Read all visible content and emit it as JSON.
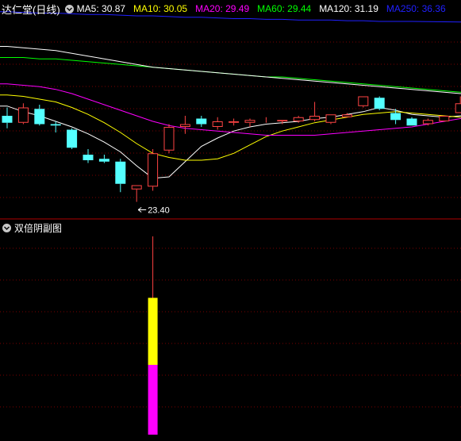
{
  "header": {
    "stock_title": "达仁堂(日线)",
    "ma_labels": [
      {
        "text": "MA5: 30.87",
        "color": "#ffffff"
      },
      {
        "text": "MA10: 30.05",
        "color": "#ffff00"
      },
      {
        "text": "MA20: 29.49",
        "color": "#ff00ff"
      },
      {
        "text": "MA60: 29.44",
        "color": "#00ff00"
      },
      {
        "text": "MA120: 31.19",
        "color": "#ffffff"
      },
      {
        "text": "MA250: 36.36",
        "color": "#2020ff"
      }
    ]
  },
  "sub_panel": {
    "title": "双倍阴副图"
  },
  "colors": {
    "up": "#ff4444",
    "down": "#54ffff",
    "grid": "#7a0000",
    "divider": "#b00000",
    "volume_top": "#ffff00",
    "volume_bottom": "#ff00ff",
    "volume_wick": "#ff4040"
  },
  "chart_data": {
    "type": "candlestick",
    "price_range": [
      22.4,
      36.8
    ],
    "low_annotation": "23.40",
    "candles": [
      {
        "o": 29.6,
        "h": 30.2,
        "l": 28.7,
        "c": 29.1
      },
      {
        "o": 29.1,
        "h": 30.5,
        "l": 29.0,
        "c": 30.2
      },
      {
        "o": 30.1,
        "h": 30.4,
        "l": 28.9,
        "c": 29.0
      },
      {
        "o": 29.0,
        "h": 29.2,
        "l": 28.4,
        "c": 28.9
      },
      {
        "o": 28.6,
        "h": 28.7,
        "l": 27.2,
        "c": 27.3
      },
      {
        "o": 26.8,
        "h": 27.2,
        "l": 26.2,
        "c": 26.4
      },
      {
        "o": 26.5,
        "h": 26.8,
        "l": 26.2,
        "c": 26.3
      },
      {
        "o": 26.3,
        "h": 26.5,
        "l": 24.1,
        "c": 24.7
      },
      {
        "o": 24.3,
        "h": 24.6,
        "l": 23.4,
        "c": 24.6
      },
      {
        "o": 24.5,
        "h": 27.2,
        "l": 24.2,
        "c": 26.9
      },
      {
        "o": 27.1,
        "h": 29.0,
        "l": 26.9,
        "c": 28.8
      },
      {
        "o": 28.8,
        "h": 29.6,
        "l": 28.3,
        "c": 29.0
      },
      {
        "o": 29.4,
        "h": 29.6,
        "l": 28.8,
        "c": 29.0
      },
      {
        "o": 28.8,
        "h": 29.5,
        "l": 28.6,
        "c": 29.2
      },
      {
        "o": 29.1,
        "h": 29.4,
        "l": 28.9,
        "c": 29.2
      },
      {
        "o": 29.1,
        "h": 29.4,
        "l": 28.8,
        "c": 29.3
      },
      {
        "o": 29.3,
        "h": 29.5,
        "l": 29.1,
        "c": 29.3
      },
      {
        "o": 29.2,
        "h": 29.3,
        "l": 29.0,
        "c": 29.3
      },
      {
        "o": 29.2,
        "h": 29.6,
        "l": 29.1,
        "c": 29.5
      },
      {
        "o": 29.3,
        "h": 30.6,
        "l": 29.2,
        "c": 29.6
      },
      {
        "o": 29.1,
        "h": 29.7,
        "l": 29.0,
        "c": 29.7
      },
      {
        "o": 29.5,
        "h": 29.8,
        "l": 29.5,
        "c": 29.7
      },
      {
        "o": 30.3,
        "h": 30.5,
        "l": 30.2,
        "c": 31.0
      },
      {
        "o": 30.9,
        "h": 31.0,
        "l": 30.0,
        "c": 30.1
      },
      {
        "o": 29.8,
        "h": 30.1,
        "l": 29.0,
        "c": 29.3
      },
      {
        "o": 29.4,
        "h": 29.5,
        "l": 28.9,
        "c": 28.9
      },
      {
        "o": 29.0,
        "h": 29.4,
        "l": 28.9,
        "c": 29.3
      },
      {
        "o": 29.2,
        "h": 29.6,
        "l": 29.2,
        "c": 29.6
      },
      {
        "o": 29.8,
        "h": 31.0,
        "l": 29.8,
        "c": 30.5
      }
    ],
    "ma_lines": [
      {
        "name": "MA5",
        "color": "#ffffff",
        "values": [
          30.3,
          29.9,
          29.6,
          29.2,
          28.8,
          28.3,
          27.7,
          27.0,
          26.0,
          25.1,
          25.2,
          26.3,
          27.4,
          28.0,
          28.5,
          28.8,
          29.0,
          29.1,
          29.2,
          29.4,
          29.5,
          29.7,
          29.9,
          30.2,
          30.0,
          29.7,
          29.6,
          29.5,
          29.6
        ]
      },
      {
        "name": "MA10",
        "color": "#ffff00",
        "values": [
          31.1,
          31.0,
          30.8,
          30.6,
          30.2,
          29.7,
          29.1,
          28.4,
          27.6,
          26.9,
          26.6,
          26.4,
          26.4,
          26.5,
          26.9,
          27.5,
          28.1,
          28.5,
          28.8,
          29.1,
          29.3,
          29.5,
          29.7,
          29.8,
          29.9,
          29.8,
          29.7,
          29.6,
          29.5
        ]
      },
      {
        "name": "MA20",
        "color": "#ff00ff",
        "values": [
          31.9,
          31.8,
          31.7,
          31.5,
          31.2,
          30.8,
          30.4,
          30.0,
          29.6,
          29.2,
          28.9,
          28.7,
          28.6,
          28.5,
          28.4,
          28.3,
          28.2,
          28.2,
          28.2,
          28.2,
          28.3,
          28.4,
          28.5,
          28.6,
          28.7,
          28.8,
          29.0,
          29.2,
          29.4
        ]
      },
      {
        "name": "MA60",
        "color": "#00ff00",
        "values": [
          33.8,
          33.8,
          33.7,
          33.7,
          33.6,
          33.5,
          33.4,
          33.3,
          33.2,
          33.1,
          33.0,
          32.9,
          32.8,
          32.7,
          32.6,
          32.5,
          32.4,
          32.4,
          32.3,
          32.2,
          32.1,
          32.0,
          31.9,
          31.8,
          31.7,
          31.6,
          31.5,
          31.4,
          31.3
        ]
      },
      {
        "name": "MA120",
        "color": "#ffffff",
        "values": [
          34.6,
          34.5,
          34.4,
          34.3,
          34.1,
          33.9,
          33.7,
          33.5,
          33.3,
          33.1,
          33.0,
          32.9,
          32.8,
          32.7,
          32.6,
          32.5,
          32.4,
          32.3,
          32.2,
          32.1,
          32.0,
          31.9,
          31.8,
          31.7,
          31.6,
          31.5,
          31.4,
          31.3,
          31.2
        ]
      },
      {
        "name": "MA250",
        "color": "#2020ff",
        "values": [
          37.1,
          37.05,
          37.0,
          37.0,
          36.95,
          36.9,
          36.9,
          36.85,
          36.8,
          36.8,
          36.75,
          36.7,
          36.7,
          36.65,
          36.6,
          36.6,
          36.55,
          36.55,
          36.5,
          36.5,
          36.5,
          36.45,
          36.45,
          36.4,
          36.4,
          36.4,
          36.38,
          36.37,
          36.36
        ]
      }
    ],
    "sub_bar": {
      "index": 9,
      "total_fraction": 1.0,
      "yellow_fraction": 0.49,
      "wick_fraction": 0.31
    }
  }
}
